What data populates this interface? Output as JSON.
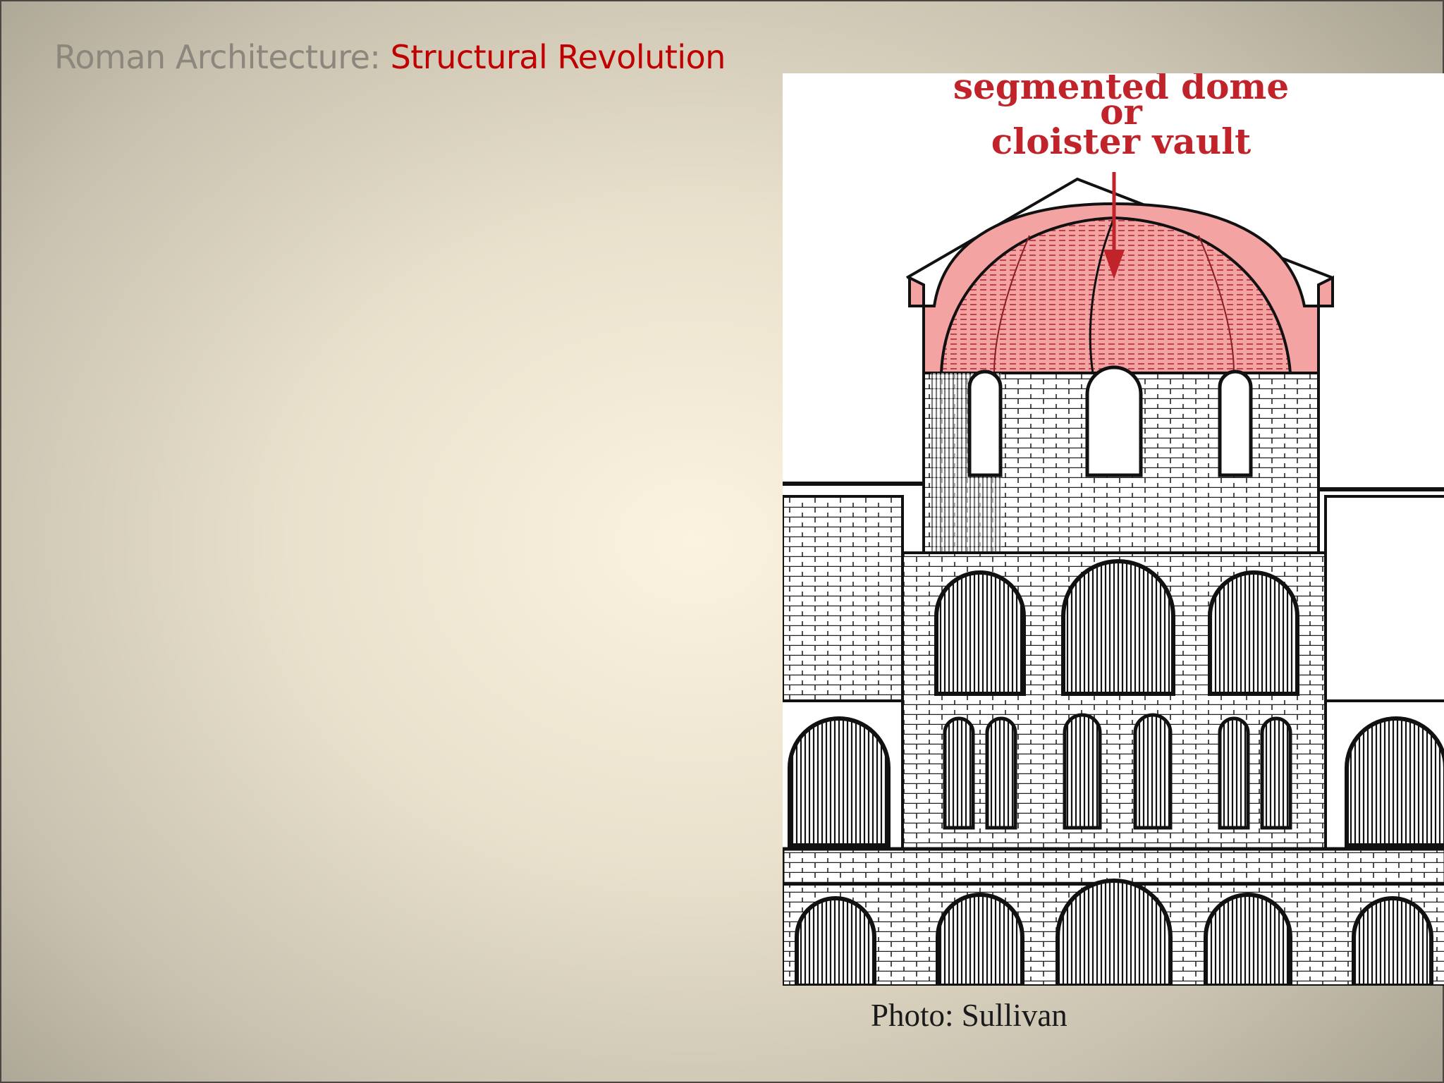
{
  "slide": {
    "title_prefix": "Roman Architecture: ",
    "title_highlight": "Structural Revolution",
    "caption": "Photo: Sullivan"
  },
  "figure": {
    "label_line1": "segmented dome",
    "label_line2": "or",
    "label_line3": "cloister vault"
  },
  "colors": {
    "title_grey": "#8c877d",
    "title_red": "#c00000",
    "dome_fill": "#f4a3a3",
    "label_red": "#c0242a"
  }
}
